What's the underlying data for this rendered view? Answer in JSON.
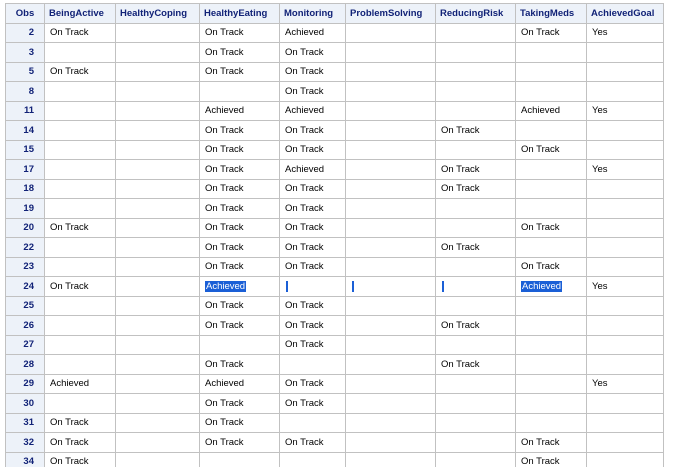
{
  "columns": [
    "Obs",
    "BeingActive",
    "HealthyCoping",
    "HealthyEating",
    "Monitoring",
    "ProblemSolving",
    "ReducingRisk",
    "TakingMeds",
    "AchievedGoal"
  ],
  "rows": [
    {
      "obs": "2",
      "cells": [
        "On Track",
        "",
        "On Track",
        "Achieved",
        "",
        "",
        "On Track",
        "Yes"
      ]
    },
    {
      "obs": "3",
      "cells": [
        "",
        "",
        "On Track",
        "On Track",
        "",
        "",
        "",
        ""
      ]
    },
    {
      "obs": "5",
      "cells": [
        "On Track",
        "",
        "On Track",
        "On Track",
        "",
        "",
        "",
        ""
      ]
    },
    {
      "obs": "8",
      "cells": [
        "",
        "",
        "",
        "On Track",
        "",
        "",
        "",
        ""
      ]
    },
    {
      "obs": "11",
      "cells": [
        "",
        "",
        "Achieved",
        "Achieved",
        "",
        "",
        "Achieved",
        "Yes"
      ]
    },
    {
      "obs": "14",
      "cells": [
        "",
        "",
        "On Track",
        "On Track",
        "",
        "On Track",
        "",
        ""
      ]
    },
    {
      "obs": "15",
      "cells": [
        "",
        "",
        "On Track",
        "On Track",
        "",
        "",
        "On Track",
        ""
      ]
    },
    {
      "obs": "17",
      "cells": [
        "",
        "",
        "On Track",
        "Achieved",
        "",
        "On Track",
        "",
        "Yes"
      ]
    },
    {
      "obs": "18",
      "cells": [
        "",
        "",
        "On Track",
        "On Track",
        "",
        "On Track",
        "",
        ""
      ]
    },
    {
      "obs": "19",
      "cells": [
        "",
        "",
        "On Track",
        "On Track",
        "",
        "",
        "",
        ""
      ]
    },
    {
      "obs": "20",
      "cells": [
        "On Track",
        "",
        "On Track",
        "On Track",
        "",
        "",
        "On Track",
        ""
      ]
    },
    {
      "obs": "22",
      "cells": [
        "",
        "",
        "On Track",
        "On Track",
        "",
        "On Track",
        "",
        ""
      ]
    },
    {
      "obs": "23",
      "cells": [
        "",
        "",
        "On Track",
        "On Track",
        "",
        "",
        "On Track",
        ""
      ]
    },
    {
      "obs": "24",
      "cells": [
        "On Track",
        "",
        "Achieved",
        "",
        "",
        "",
        "Achieved",
        "Yes"
      ],
      "selected_cols": [
        2,
        3,
        4,
        5,
        6
      ]
    },
    {
      "obs": "25",
      "cells": [
        "",
        "",
        "On Track",
        "On Track",
        "",
        "",
        "",
        ""
      ]
    },
    {
      "obs": "26",
      "cells": [
        "",
        "",
        "On Track",
        "On Track",
        "",
        "On Track",
        "",
        ""
      ]
    },
    {
      "obs": "27",
      "cells": [
        "",
        "",
        "",
        "On Track",
        "",
        "",
        "",
        ""
      ]
    },
    {
      "obs": "28",
      "cells": [
        "",
        "",
        "On Track",
        "",
        "",
        "On Track",
        "",
        ""
      ]
    },
    {
      "obs": "29",
      "cells": [
        "Achieved",
        "",
        "Achieved",
        "On Track",
        "",
        "",
        "",
        "Yes"
      ]
    },
    {
      "obs": "30",
      "cells": [
        "",
        "",
        "On Track",
        "On Track",
        "",
        "",
        "",
        ""
      ]
    },
    {
      "obs": "31",
      "cells": [
        "On Track",
        "",
        "On Track",
        "",
        "",
        "",
        "",
        ""
      ]
    },
    {
      "obs": "32",
      "cells": [
        "On Track",
        "",
        "On Track",
        "On Track",
        "",
        "",
        "On Track",
        ""
      ]
    },
    {
      "obs": "34",
      "cells": [
        "On Track",
        "",
        "",
        "",
        "",
        "",
        "On Track",
        ""
      ]
    }
  ],
  "colors": {
    "header_bg": "#edf2f9",
    "header_text": "#112277",
    "border": "#c1c1c1",
    "selection": "#1a5fd6"
  }
}
